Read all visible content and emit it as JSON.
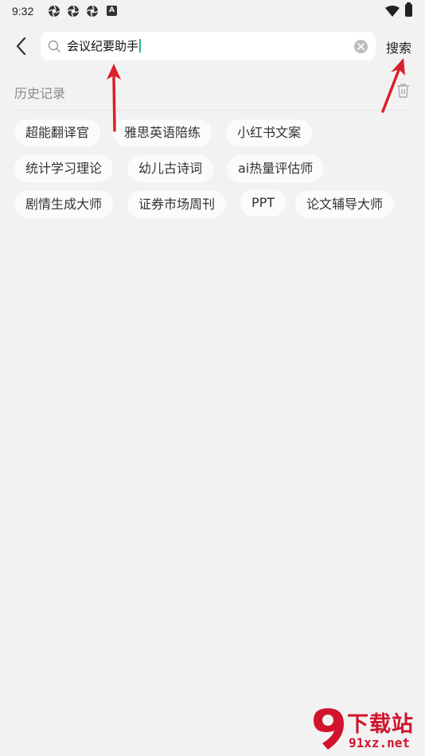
{
  "status_bar": {
    "time": "9:32",
    "icons": [
      "aperture-icon",
      "aperture-icon",
      "aperture-icon",
      "a-box-icon",
      "wifi-icon",
      "battery-icon"
    ],
    "a_icon_letter": "A"
  },
  "search": {
    "query": "会议纪要助手",
    "button_label": "搜索"
  },
  "history": {
    "title": "历史记录",
    "items": [
      "超能翻译官",
      "雅思英语陪练",
      "小红书文案",
      "统计学习理论",
      "幼儿古诗词",
      "ai热量评估师",
      "剧情生成大师",
      "证券市场周刊",
      "PPT",
      "论文辅导大师"
    ]
  },
  "colors": {
    "background": "#f2f2f2",
    "chip": "#fbfbfb",
    "caret": "#2db38a",
    "annotation_arrow": "#d9202b",
    "watermark": "#d1142c"
  },
  "watermark": {
    "logo_text": "9",
    "brand": "下载站",
    "url": "91xz.net"
  }
}
